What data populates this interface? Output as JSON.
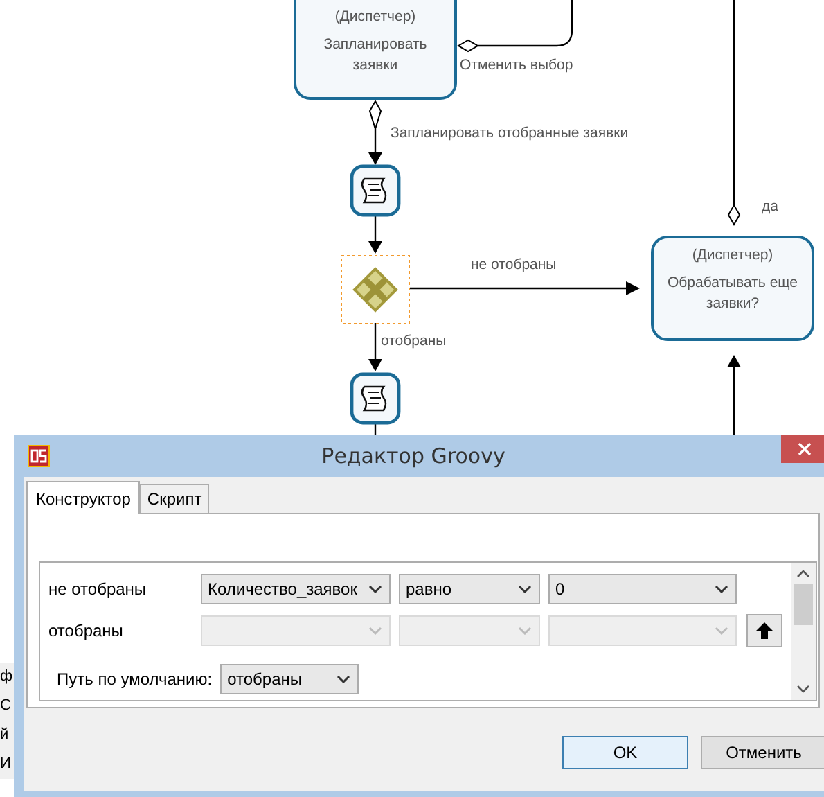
{
  "diagram": {
    "tasks": [
      {
        "role": "(Диспетчер)",
        "name": "Запланировать заявки"
      },
      {
        "role": "(Диспетчер)",
        "name": "Обрабатывать еще заявки?"
      }
    ],
    "flow_labels": [
      "Отменить выбор",
      "Запланировать отобранные заявки",
      "не отобраны",
      "отобраны",
      "да"
    ],
    "script_tasks": [
      {
        "kind": "script"
      },
      {
        "kind": "script"
      }
    ],
    "gateway": {
      "selected": true
    }
  },
  "background_fragments": [
    "ф",
    "С",
    "й",
    "И"
  ],
  "dialog": {
    "title": "Редактор Groovy",
    "tabs": [
      {
        "label": "Конструктор",
        "selected": true
      },
      {
        "label": "Скрипт",
        "selected": false
      }
    ],
    "conditions": [
      {
        "label": "не отобраны",
        "disabled": false,
        "move_up": false,
        "fields": [
          "Количество_заявок",
          "равно",
          "0"
        ]
      },
      {
        "label": "отобраны",
        "disabled": true,
        "move_up": true
      }
    ],
    "default_path": {
      "label": "Путь по умолчанию:",
      "value": "отобраны"
    },
    "buttons": [
      {
        "label": "OK",
        "default": true
      },
      {
        "label": "Отменить",
        "default": false
      }
    ]
  }
}
